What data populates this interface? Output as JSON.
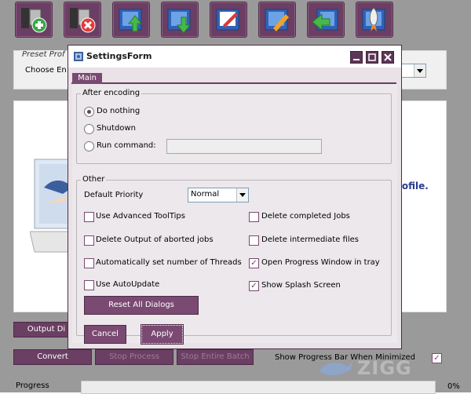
{
  "main_window": {
    "toolbar": [
      {
        "name": "add-job-icon"
      },
      {
        "name": "remove-job-icon"
      },
      {
        "name": "move-up-icon"
      },
      {
        "name": "move-down-icon"
      },
      {
        "name": "edit-icon"
      },
      {
        "name": "clear-icon"
      },
      {
        "name": "import-icon"
      },
      {
        "name": "launch-icon"
      }
    ],
    "preset_group_label": "Preset Prof",
    "choose_label": "Choose En",
    "hint_profile": "rofile.",
    "hint_dot": ".",
    "buttons": {
      "output_dir": "Output Di",
      "convert": "Convert",
      "stop_process": "Stop Process",
      "stop_batch": "Stop Entire Batch"
    },
    "show_progress_label": "Show Progress Bar When Minimized",
    "show_progress_checked": true,
    "progress_label": "Progress",
    "progress_value": "0%",
    "progress_fraction": 0,
    "watermark": "ZIGG"
  },
  "dialog": {
    "title": "SettingsForm",
    "tabs": [
      "Main"
    ],
    "after_encoding": {
      "legend": "After encoding",
      "options": [
        {
          "label": "Do nothing",
          "selected": true
        },
        {
          "label": "Shutdown",
          "selected": false
        },
        {
          "label": "Run command:",
          "selected": false
        }
      ],
      "run_command_value": ""
    },
    "other": {
      "legend": "Other",
      "priority_label": "Default Priority",
      "priority_value": "Normal",
      "left_checks": [
        {
          "label": "Use Advanced ToolTips",
          "checked": false
        },
        {
          "label": "Delete Output of aborted jobs",
          "checked": false
        },
        {
          "label": "Automatically set number of Threads",
          "checked": false
        },
        {
          "label": "Use AutoUpdate",
          "checked": false
        }
      ],
      "right_checks": [
        {
          "label": "Delete completed Jobs",
          "checked": false
        },
        {
          "label": "Delete intermediate files",
          "checked": false
        },
        {
          "label": "Open Progress Window in tray",
          "checked": true
        },
        {
          "label": "Show Splash Screen",
          "checked": true
        }
      ],
      "reset_button": "Reset All Dialogs"
    },
    "cancel_button": "Cancel",
    "apply_button": "Apply"
  },
  "colors": {
    "accent": "#6a3f63",
    "hint_text": "#2a3b8f"
  }
}
